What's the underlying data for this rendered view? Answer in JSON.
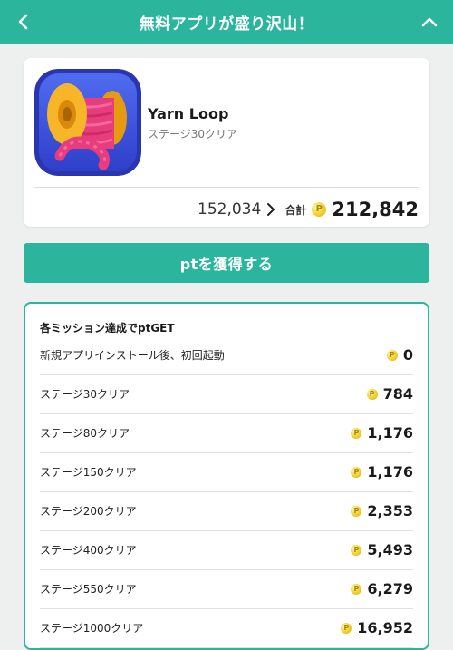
{
  "header": {
    "title": "無料アプリが盛り沢山！",
    "back_icon": "chevron-left-icon",
    "collapse_icon": "chevron-up-icon"
  },
  "app": {
    "name": "Yarn Loop",
    "subtitle": "ステージ30クリア",
    "old_price": "152,034",
    "total_label": "合計",
    "total_value": "212,842"
  },
  "action": {
    "get_button_label": "ptを獲得する"
  },
  "missions": {
    "title": "各ミッション達成でptGET",
    "items": [
      {
        "label": "新規アプリインストール後、初回起動",
        "points": "0"
      },
      {
        "label": "ステージ30クリア",
        "points": "784"
      },
      {
        "label": "ステージ80クリア",
        "points": "1,176"
      },
      {
        "label": "ステージ150クリア",
        "points": "1,176"
      },
      {
        "label": "ステージ200クリア",
        "points": "2,353"
      },
      {
        "label": "ステージ400クリア",
        "points": "5,493"
      },
      {
        "label": "ステージ550クリア",
        "points": "6,279"
      },
      {
        "label": "ステージ1000クリア",
        "points": "16,952"
      }
    ]
  },
  "colors": {
    "accent": "#2cb59d",
    "background": "#eef0f0",
    "coin": "#f2cf2e"
  }
}
